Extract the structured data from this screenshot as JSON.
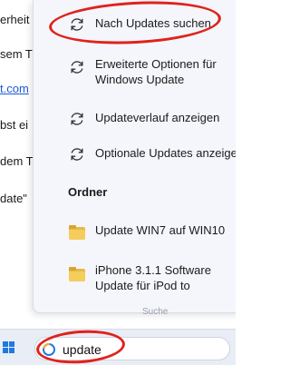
{
  "background_fragments": [
    {
      "text": "erheit"
    },
    {
      "text": "sem T"
    },
    {
      "text": "t.com"
    },
    {
      "text": "bst ei"
    },
    {
      "text": "dem T"
    },
    {
      "text": "date\""
    }
  ],
  "flyout": {
    "actions": [
      {
        "label": "Nach Updates suchen",
        "icon": "refresh-icon"
      },
      {
        "label": "Erweiterte Optionen für Windows Update",
        "icon": "refresh-icon"
      },
      {
        "label": "Updateverlauf anzeigen",
        "icon": "refresh-icon"
      },
      {
        "label": "Optionale Updates anzeigen",
        "icon": "refresh-icon"
      }
    ],
    "folders_title": "Ordner",
    "folders": [
      {
        "label": "Update WIN7 auf WIN10",
        "icon": "folder-icon"
      },
      {
        "label": "iPhone 3.1.1 Software Update für iPod to",
        "icon": "folder-icon"
      }
    ],
    "suche_hint": "Suche"
  },
  "taskbar": {
    "search_value": "update"
  },
  "colors": {
    "accent": "#1f7ae0",
    "annotation": "#e0221c",
    "folder": "#f5cd5d"
  }
}
